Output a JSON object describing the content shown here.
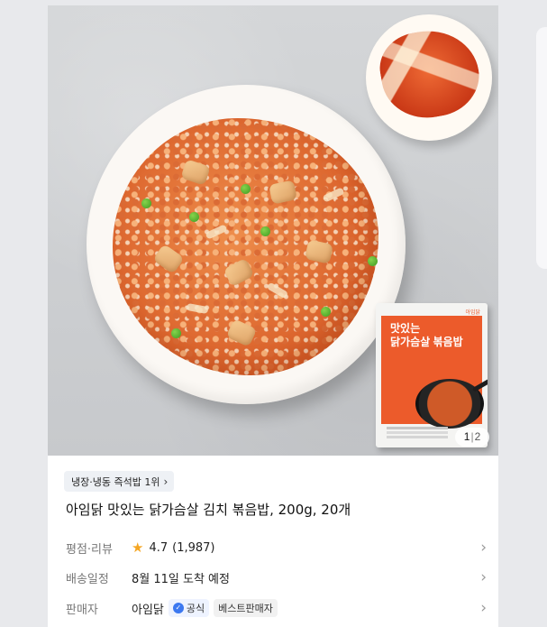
{
  "product_image": {
    "package": {
      "brand": "아임닭",
      "title_line1": "맛있는",
      "title_line2": "닭가슴살 볶음밥"
    },
    "counter": {
      "current": "1",
      "total": "2"
    }
  },
  "badge": {
    "text": "냉장·냉동 즉석밥 1위"
  },
  "product": {
    "title": "아임닭 맛있는 닭가슴살 김치 볶음밥, 200g, 20개"
  },
  "info": {
    "rating": {
      "label": "평점·리뷰",
      "score": "4.7",
      "count": "(1,987)"
    },
    "delivery": {
      "label": "배송일정",
      "text": "8월 11일 도착 예정"
    },
    "seller": {
      "label": "판매자",
      "name": "아임닭",
      "official_badge": "공식",
      "best_badge": "베스트판매자"
    }
  },
  "colors": {
    "page_background": "#e8e9ec",
    "card_background": "#ffffff",
    "badge_background": "#eef1f5",
    "star": "#f5a623",
    "official_blue": "#3c78f0",
    "package_red": "#ec5b2b"
  },
  "icons": {
    "badge_chevron": "chevron-right-icon",
    "rating": "star-icon",
    "row_arrow": "chevron-right-icon",
    "official": "shield-check-icon"
  }
}
